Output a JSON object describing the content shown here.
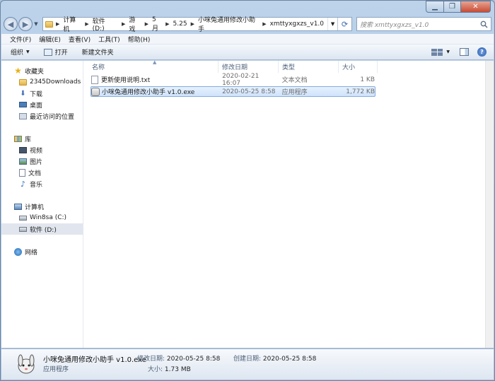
{
  "window": {
    "caption": {
      "minimize": "▁",
      "maximize": "❐",
      "close": "✕"
    }
  },
  "address": {
    "crumbs": [
      "计算机",
      "软件 (D:)",
      "游戏",
      "5月",
      "5.25",
      "小咪兔通用修改小助手",
      "xmttyxgxzs_v1.0"
    ],
    "search_placeholder": "搜索 xmttyxgxzs_v1.0"
  },
  "menu": [
    "文件(F)",
    "编辑(E)",
    "查看(V)",
    "工具(T)",
    "帮助(H)"
  ],
  "toolbar": {
    "organize": "组织",
    "open": "打开",
    "new_folder": "新建文件夹"
  },
  "nav": {
    "favorites": {
      "label": "收藏夹",
      "items": [
        "2345Downloads",
        "下载",
        "桌面",
        "最近访问的位置"
      ]
    },
    "libraries": {
      "label": "库",
      "items": [
        "视频",
        "图片",
        "文档",
        "音乐"
      ]
    },
    "computer": {
      "label": "计算机",
      "items": [
        "Win8sa (C:)",
        "软件 (D:)"
      ]
    },
    "network": {
      "label": "网络"
    }
  },
  "columns": {
    "name": "名称",
    "date": "修改日期",
    "type": "类型",
    "size": "大小"
  },
  "files": [
    {
      "name": "更新使用说明.txt",
      "date": "2020-02-21 16:07",
      "type": "文本文档",
      "size": "1 KB"
    },
    {
      "name": "小咪兔通用修改小助手 v1.0.exe",
      "date": "2020-05-25 8:58",
      "type": "应用程序",
      "size": "1,772 KB"
    }
  ],
  "details": {
    "name": "小咪兔通用修改小助手 v1.0.exe",
    "type": "应用程序",
    "modified_label": "修改日期:",
    "modified": "2020-05-25 8:58",
    "created_label": "创建日期:",
    "created": "2020-05-25 8:58",
    "size_label": "大小:",
    "size": "1.73 MB"
  }
}
